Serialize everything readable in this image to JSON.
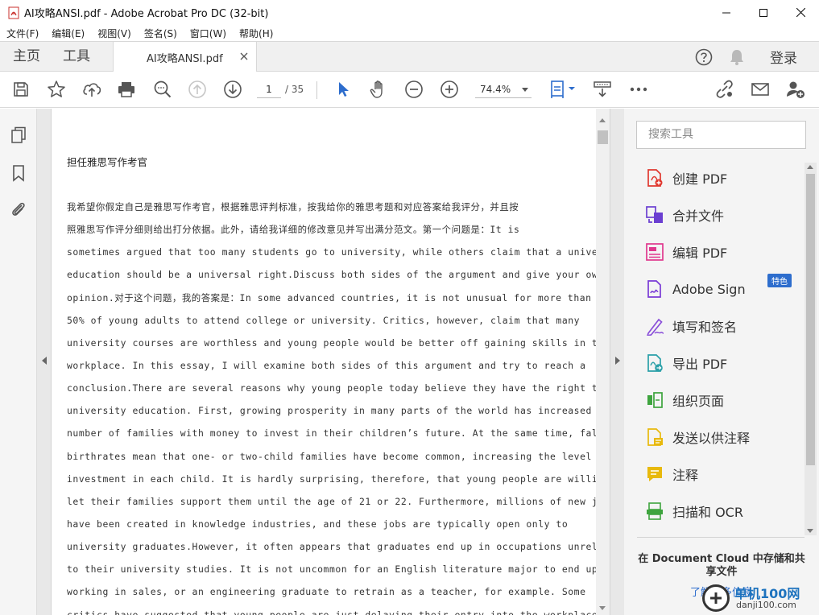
{
  "window": {
    "title": "AI攻略ANSI.pdf - Adobe Acrobat Pro DC (32-bit)"
  },
  "menu": [
    "文件(F)",
    "编辑(E)",
    "视图(V)",
    "签名(S)",
    "窗口(W)",
    "帮助(H)"
  ],
  "tabs": {
    "home": "主页",
    "tools": "工具",
    "document": "AI攻略ANSI.pdf",
    "login": "登录"
  },
  "toolbar": {
    "current_page": "1",
    "total_pages": "/ 35",
    "zoom": "74.4%"
  },
  "document": {
    "heading": "担任雅思写作考官",
    "lines": [
      "我希望你假定自己是雅思写作考官，根据雅思评判标准，按我给你的雅思考题和对应答案给我评分，并且按",
      "照雅思写作评分细则给出打分依据。此外，请给我详细的修改意见并写出满分范文。第一个问题是：It is",
      "sometimes argued that too many students go to university, while others claim that a university",
      "education should be a universal right.Discuss both sides of the argument and give your own",
      "opinion.对于这个问题，我的答案是：In some advanced countries, it is not unusual for more than",
      "50% of young adults to attend college or university. Critics, however, claim that many",
      "university courses are worthless and young people would be better off gaining skills in the",
      "workplace. In this essay, I will examine both sides of this argument and try to reach a",
      "conclusion.There are several reasons why young people today believe they have the right to a",
      "university education. First, growing prosperity in many parts of the world has increased the",
      "number of families with money to invest in their children’s future. At the same time, falling",
      "birthrates mean that one- or two-child families have become common, increasing the level of",
      "investment in each child. It is hardly surprising, therefore, that young people are willing to",
      "let their families support them until the age of 21 or 22. Furthermore, millions of new jobs",
      "have been created in knowledge industries, and these jobs are typically open only to",
      "university graduates.However, it often appears that graduates end up in occupations unrelated",
      "to their university studies. It is not uncommon for an English literature major to end up",
      "working in sales, or an engineering graduate to retrain as a teacher, for example. Some",
      "critics have suggested that young people are just delaying their entry into the workplace,"
    ]
  },
  "tools_pane": {
    "search_placeholder": "搜索工具",
    "items": [
      {
        "label": "创建 PDF",
        "icon": "create-pdf-icon",
        "color": "#e0382f"
      },
      {
        "label": "合并文件",
        "icon": "combine-files-icon",
        "color": "#6b3fd1"
      },
      {
        "label": "编辑 PDF",
        "icon": "edit-pdf-icon",
        "color": "#e0388e"
      },
      {
        "label": "Adobe Sign",
        "icon": "adobe-sign-icon",
        "color": "#7a3ad6",
        "badge": "特色"
      },
      {
        "label": "填写和签名",
        "icon": "fill-sign-icon",
        "color": "#8a4fd9"
      },
      {
        "label": "导出 PDF",
        "icon": "export-pdf-icon",
        "color": "#2aa0a8"
      },
      {
        "label": "组织页面",
        "icon": "organize-pages-icon",
        "color": "#3ea43e"
      },
      {
        "label": "发送以供注释",
        "icon": "send-comment-icon",
        "color": "#e8b90c"
      },
      {
        "label": "注释",
        "icon": "comment-icon",
        "color": "#e8b90c"
      },
      {
        "label": "扫描和 OCR",
        "icon": "scan-ocr-icon",
        "color": "#3ea43e"
      }
    ],
    "cloud_text": "在 Document Cloud 中存储和共享文件",
    "cloud_link": "了解更多信息"
  },
  "watermark": {
    "name": "单机100网",
    "url": "danji100.com"
  },
  "colors": {
    "accent": "#2d6dcd",
    "pdf_red": "#e0382f"
  }
}
